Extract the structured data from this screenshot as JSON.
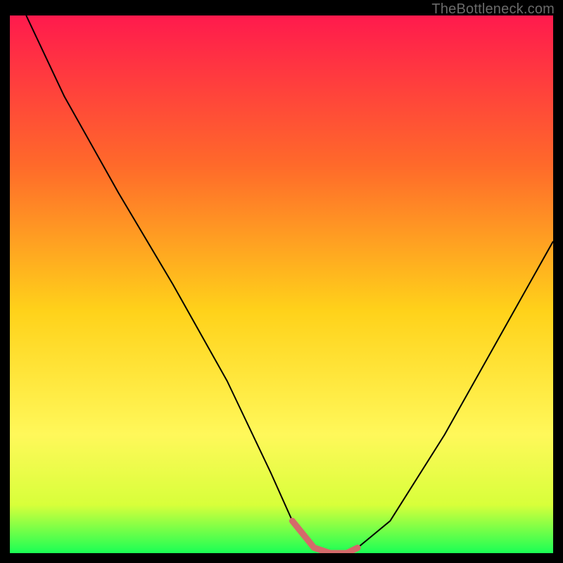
{
  "watermark": {
    "text": "TheBottleneck.com"
  },
  "colors": {
    "gradient_stops": [
      "#ff1a4d",
      "#ff6a2a",
      "#ffd21a",
      "#fff85a",
      "#d8ff3a",
      "#1aff55"
    ],
    "curve_stroke": "#000000",
    "highlight_stroke": "#d46a6a"
  },
  "chart_data": {
    "type": "line",
    "title": "",
    "xlabel": "",
    "ylabel": "",
    "xlim": [
      0,
      100
    ],
    "ylim": [
      0,
      100
    ],
    "series": [
      {
        "name": "bottleneck-curve",
        "x": [
          3,
          10,
          20,
          30,
          40,
          48,
          52,
          56,
          59,
          62,
          64,
          70,
          80,
          90,
          100
        ],
        "y": [
          100,
          85,
          67,
          50,
          32,
          15,
          6,
          1,
          0,
          0,
          1,
          6,
          22,
          40,
          58
        ]
      }
    ],
    "highlight_region": {
      "name": "optimal-range",
      "x": [
        52,
        56,
        59,
        62,
        64
      ],
      "y": [
        6,
        1,
        0,
        0,
        1
      ]
    }
  }
}
